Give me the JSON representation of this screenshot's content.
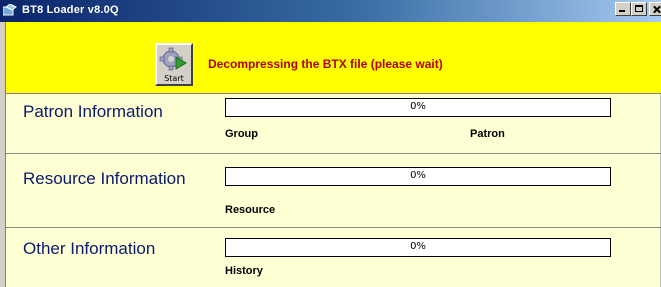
{
  "window": {
    "title": "BT8 Loader  v8.0Q",
    "app_icon": "bt8-loader-icon",
    "controls": [
      "minimize-icon",
      "maximize-icon",
      "close-icon"
    ]
  },
  "banner": {
    "background": "#ffff00",
    "start_button_label": "Start",
    "start_button_icon": "gear-play-icon",
    "status_message": "Decompressing the BTX file (please wait)",
    "status_color": "#b30000"
  },
  "sections": [
    {
      "title": "Patron Information",
      "progress_text": "0%",
      "progress": 0,
      "labels": [
        "Group",
        "Patron"
      ]
    },
    {
      "title": "Resource Information",
      "progress_text": "0%",
      "progress": 0,
      "labels": [
        "Resource"
      ]
    },
    {
      "title": "Other Information",
      "progress_text": "0%",
      "progress": 0,
      "labels": [
        "History"
      ]
    }
  ],
  "colors": {
    "panel_background": "#ffffd4",
    "section_title": "#0a1a6e"
  }
}
